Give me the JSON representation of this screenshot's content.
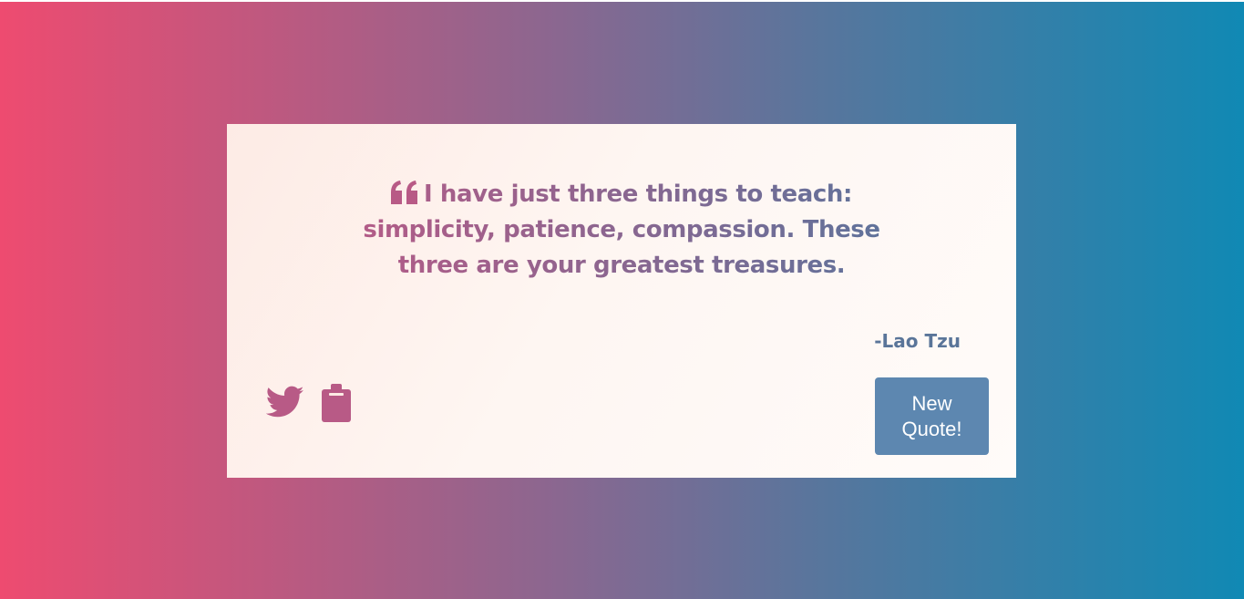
{
  "quote": {
    "icon": "quote-left-icon",
    "text": "I have just three things to teach: simplicity, patience, compassion. These three are your greatest treasures.",
    "author": "-Lao Tzu"
  },
  "actions": {
    "tweet_icon": "twitter-icon",
    "copy_icon": "clipboard-icon",
    "new_quote_label": "New Quote!"
  },
  "colors": {
    "gradient_left": "#ee4b70",
    "gradient_right": "#1089b4",
    "accent": "#b85a86",
    "button_bg": "#5d87b0",
    "author": "#5a7599"
  }
}
